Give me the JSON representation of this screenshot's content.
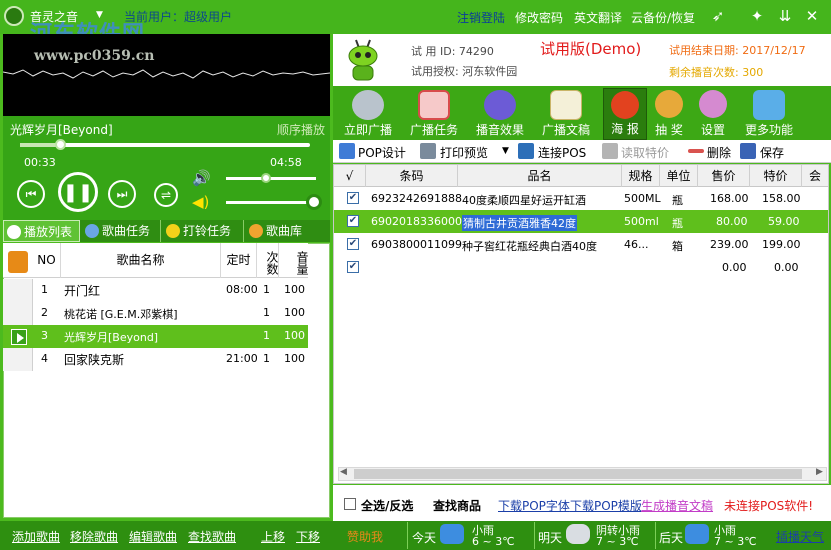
{
  "app": {
    "name": "音灵之音",
    "user_label": "当前用户：超级用户",
    "watermark_site": "河东软件网",
    "watermark_url": "www.pc0359.cn"
  },
  "titlebar": {
    "links": [
      "注销登陆",
      "修改密码",
      "英文翻译",
      "云备份/恢复"
    ],
    "win_buttons": [
      "rocket-icon",
      "skin-icon",
      "minimize-icon",
      "close-icon"
    ]
  },
  "player": {
    "song": "光辉岁月[Beyond]",
    "play_mode": "顺序播放",
    "elapsed": "00:33",
    "total": "04:58",
    "progress": 0.11,
    "volume": 0.45,
    "balance": 1.0
  },
  "left_tabs": [
    "播放列表",
    "歌曲任务",
    "打铃任务",
    "歌曲库"
  ],
  "playlist": {
    "headers": {
      "no": "NO",
      "name": "歌曲名称",
      "time": "定时",
      "count": "次数",
      "vol": "音量"
    },
    "rows": [
      {
        "no": "1",
        "name": "开门红",
        "time": "08:00",
        "count": "1",
        "vol": "100"
      },
      {
        "no": "2",
        "name": "桃花诺 [G.E.M.邓紫棋]",
        "time": "",
        "count": "1",
        "vol": "100"
      },
      {
        "no": "3",
        "name": "光辉岁月[Beyond]",
        "time": "",
        "count": "1",
        "vol": "100"
      },
      {
        "no": "4",
        "name": "回家陕克斯",
        "time": "21:00",
        "count": "1",
        "vol": "100"
      }
    ]
  },
  "info": {
    "trial_id": "试 用 ID: 74290",
    "license": "试用授权: 河东软件园",
    "edition": "试用版(Demo)",
    "end_date": "试用结束日期: 2017/12/17",
    "remaining": "剩余播音次数: 300"
  },
  "big_toolbar": [
    "立即广播",
    "广播任务",
    "播音效果",
    "广播文稿",
    "海 报",
    "抽 奖",
    "设置",
    "更多功能"
  ],
  "white_toolbar": [
    "POP设计",
    "打印预览",
    "连接POS",
    "读取特价",
    "删除",
    "保存"
  ],
  "grid": {
    "headers": [
      "√",
      "条码",
      "品名",
      "规格",
      "单位",
      "售价",
      "特价",
      "会"
    ],
    "rows": [
      {
        "code": "6923242691888",
        "name": "40度柔顺四星好运开缸酒",
        "spec": "500ML",
        "unit": "瓶",
        "price": "168.00",
        "special": "158.00"
      },
      {
        "code": "6902018336000",
        "name": "猜制古井贡酒雅香42度",
        "spec": "500ml",
        "unit": "瓶",
        "price": "80.00",
        "special": "59.00"
      },
      {
        "code": "6903800011099",
        "name": "种子窖红花瓶经典白酒40度",
        "spec": "46...",
        "unit": "箱",
        "price": "239.00",
        "special": "199.00"
      },
      {
        "code": "",
        "name": "",
        "spec": "",
        "unit": "",
        "price": "0.00",
        "special": "0.00"
      }
    ]
  },
  "grid_footer": {
    "select_all": "全选/反选",
    "find": "查找商品",
    "dl_font": "下载POP字体",
    "dl_tpl": "下载POP模版",
    "gen_text": "生成播音文稿",
    "pos_warn": "未连接POS软件!"
  },
  "status": {
    "buttons": [
      "添加歌曲",
      "移除歌曲",
      "编辑歌曲",
      "查找歌曲",
      "上移",
      "下移"
    ],
    "donate": "赞助我",
    "today": "今天",
    "today_w": "小雨",
    "today_t": "6 ~ 3℃",
    "tomorrow": "明天",
    "tomorrow_w": "阴转小雨",
    "tomorrow_t": "7 ~ 3℃",
    "after": "后天",
    "after_w": "小雨",
    "after_t": "7 ~ 3℃",
    "insert_weather": "插播天气"
  },
  "colors": {
    "green": "#4cba1e",
    "dark_green": "#2e8f10",
    "selected_row": "#5fbf1c",
    "demo_red": "#e21b1b"
  }
}
